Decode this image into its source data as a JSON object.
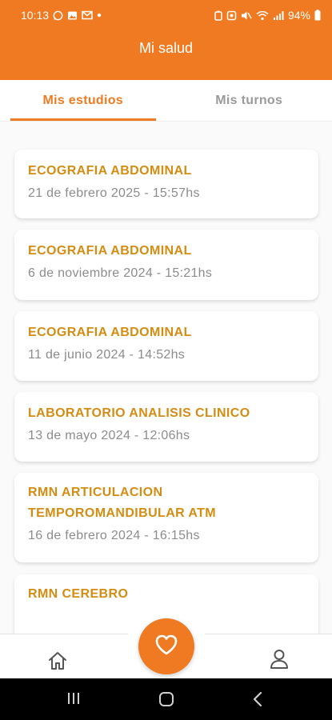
{
  "status_bar": {
    "time": "10:13",
    "battery": "94%"
  },
  "header": {
    "title": "Mi salud"
  },
  "tabs": [
    {
      "label": "Mis estudios",
      "active": true
    },
    {
      "label": "Mis turnos",
      "active": false
    }
  ],
  "studies": [
    {
      "title": "ECOGRAFIA ABDOMINAL",
      "date": "21 de febrero 2025 - 15:57hs"
    },
    {
      "title": "ECOGRAFIA ABDOMINAL",
      "date": "6 de noviembre 2024 - 15:21hs"
    },
    {
      "title": "ECOGRAFIA ABDOMINAL",
      "date": "11 de junio 2024 - 14:52hs"
    },
    {
      "title": "LABORATORIO ANALISIS CLINICO",
      "date": "13 de mayo 2024 - 12:06hs"
    },
    {
      "title_line1": "RMN ARTICULACION",
      "title_line2": "TEMPOROMANDIBULAR ATM",
      "date": "16 de febrero 2024 - 16:15hs"
    },
    {
      "title": "RMN CEREBRO"
    }
  ],
  "bottom_nav": {
    "home_icon": "home-icon",
    "center_icon": "heart-icon",
    "profile_icon": "user-icon"
  },
  "colors": {
    "primary": "#ef7a21",
    "card_title": "#d48c12",
    "card_date": "#8c8c8c",
    "tab_inactive": "#9a9a9a"
  }
}
